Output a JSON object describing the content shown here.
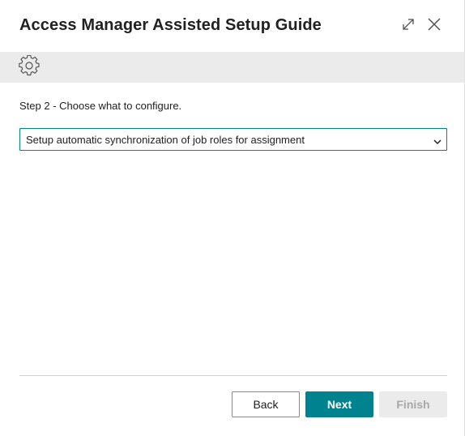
{
  "dialog": {
    "title": "Access Manager Assisted Setup Guide",
    "expand_icon": "expand-icon",
    "close_icon": "close-icon"
  },
  "action_bar": {
    "settings_icon": "gear-icon"
  },
  "content": {
    "step_label": "Step 2 - Choose what to configure.",
    "configure_select": {
      "selected_value": "Setup automatic synchronization of job roles for assignment"
    }
  },
  "footer": {
    "back_label": "Back",
    "next_label": "Next",
    "finish_label": "Finish",
    "finish_enabled": false
  },
  "colors": {
    "accent": "#00838f",
    "action_bar_bg": "#ebebeb",
    "disabled_text": "#a8a8a8"
  }
}
